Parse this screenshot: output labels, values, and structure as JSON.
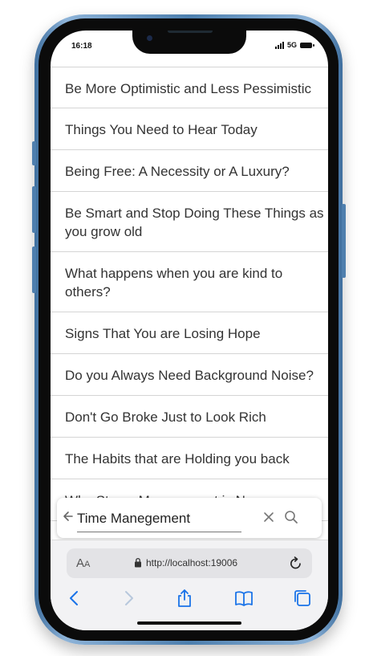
{
  "status_bar": {
    "time": "16:18",
    "network": "5G"
  },
  "articles": [
    "Be More Optimistic and Less Pessimistic",
    "Things You Need to Hear Today",
    "Being Free: A Necessity or A Luxury?",
    "Be Smart and Stop Doing These Things as you grow old",
    "What happens when you are kind to others?",
    "Signs That You are Losing Hope",
    "Do you Always Need Background Noise?",
    "Don't Go Broke Just to Look Rich",
    "The Habits that are Holding you back",
    "Why Stress Management is Necessary"
  ],
  "search": {
    "value": "Time Manegement"
  },
  "browser": {
    "url": "http://localhost:19006",
    "text_size_label_large": "A",
    "text_size_label_small": "A"
  },
  "colors": {
    "accent": "#1a73e8",
    "frame": "#4d7fae"
  }
}
